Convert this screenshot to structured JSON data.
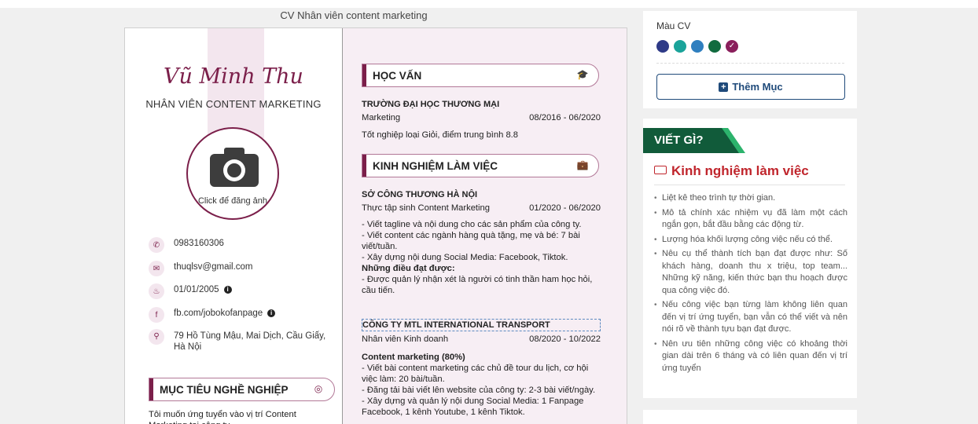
{
  "cv_title": "CV Nhân viên content marketing",
  "profile": {
    "name": "Vũ Minh Thu",
    "job_title": "NHÂN VIÊN CONTENT MARKETING",
    "avatar_label": "Click để đăng ảnh"
  },
  "contacts": [
    {
      "icon": "phone-icon",
      "text": "0983160306"
    },
    {
      "icon": "email-icon",
      "text": "thuqlsv@gmail.com"
    },
    {
      "icon": "birthday-icon",
      "text": "01/01/2005"
    },
    {
      "icon": "facebook-icon",
      "text": "fb.com/jobokofanpage"
    },
    {
      "icon": "location-icon",
      "text": "79 Hồ Tùng Mậu, Mai Dịch, Cầu Giấy, Hà Nội"
    }
  ],
  "objective": {
    "title": "MỤC TIÊU NGHỀ NGHIỆP",
    "text": "Tôi muốn ứng tuyển vào vị trí Content Marketing tại công ty"
  },
  "education": {
    "title": "HỌC VẤN",
    "school": "TRƯỜNG ĐẠI HỌC THƯƠNG MẠI",
    "major": "Marketing",
    "period": "08/2016 - 06/2020",
    "note": "Tốt nghiệp loại Giỏi, điểm trung bình 8.8"
  },
  "experience": {
    "title": "KINH NGHIỆM LÀM VIỆC",
    "jobs": [
      {
        "company": "SỞ CÔNG THƯƠNG HÀ NỘI",
        "position": "Thực tập sinh Content Marketing",
        "period": "01/2020 - 06/2020",
        "lines": [
          "- Viết tagline và nội dung cho các sản phẩm của công ty.",
          "- Viết content các ngành hàng quà tặng, mẹ và bé: 7 bài viết/tuần.",
          "- Xây dựng nội dung Social Media: Facebook, Tiktok."
        ],
        "achieve_title": "Những điều đạt được:",
        "achieve": "- Được quản lý nhận xét là người có tinh thần ham học hỏi, cầu tiến."
      },
      {
        "company": "CÔNG TY MTL INTERNATIONAL TRANSPORT",
        "position": "Nhân viên Kinh doanh",
        "period": "08/2020 - 10/2022",
        "sub_title": "Content marketing (80%)",
        "lines": [
          "- Viết bài content marketing các chủ đề tour du lịch, cơ hội việc làm: 20 bài/tuần.",
          "- Đăng tải bài viết lên website của công ty: 2-3 bài viết/ngày.",
          "- Xây dựng và quản lý nội dung Social Media: 1 Fanpage Facebook, 1 kênh Youtube, 1 kênh Tiktok."
        ]
      }
    ]
  },
  "sidebar": {
    "color_label": "Màu CV",
    "colors": [
      "#2e3a87",
      "#1aa39a",
      "#2f7fbf",
      "#116b3f",
      "#8a1f5c"
    ],
    "selected_color": "#8a1f5c",
    "add_section": "Thêm Mục",
    "guide_badge": "VIẾT GÌ?",
    "guide_title": "Kinh nghiệm làm việc",
    "tips": [
      "Liệt kê theo trình tự thời gian.",
      "Mô tả chính xác nhiệm vụ đã làm một cách ngắn gọn, bắt đầu bằng các động từ.",
      "Lượng hóa khối lượng công việc nếu có thể.",
      "Nêu cụ thể thành tích bạn đạt được như: Số khách hàng, doanh thu x triệu, top team... Những kỹ năng, kiến thức bạn thu hoạch được qua công việc đó.",
      "Nếu công việc bạn từng làm không liên quan đến vị trí ứng tuyển, bạn vẫn có thể viết và nên nói rõ về thành tựu bạn đạt được.",
      "Nên ưu tiên những công việc có khoảng thời gian dài trên 6 tháng và có liên quan đến vị trí ứng tuyển"
    ]
  }
}
